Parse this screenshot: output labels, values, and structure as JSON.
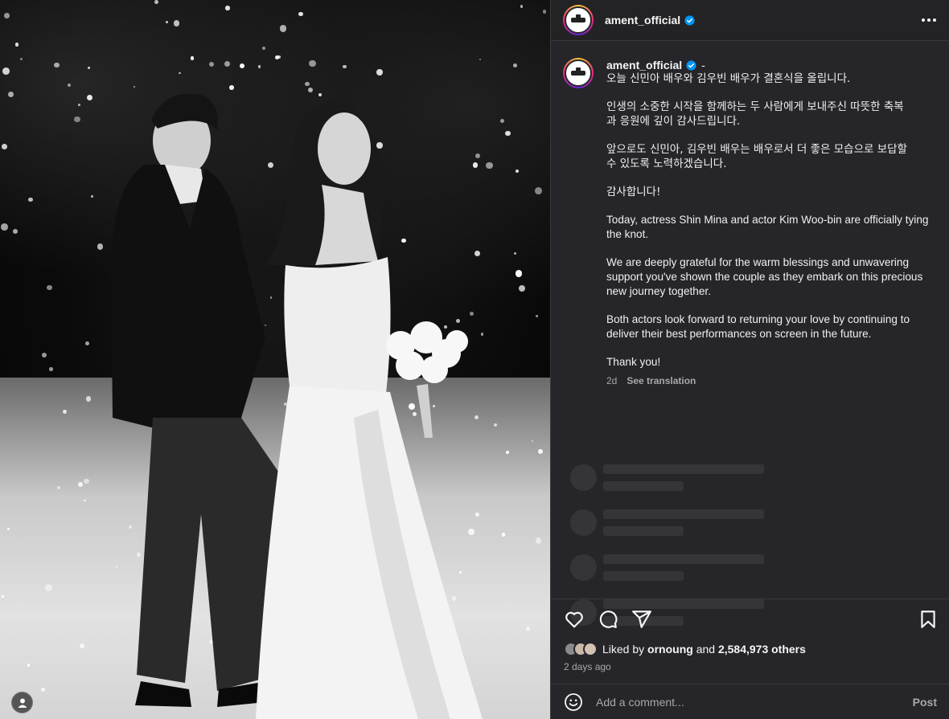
{
  "post": {
    "username": "ament_official",
    "verified": true,
    "caption_dash": "-",
    "caption_ko": [
      "오늘 신민아 배우와 김우빈 배우가 결혼식을 올립니다.",
      "인생의 소중한 시작을 함께하는 두 사람에게 보내주신 따뜻한 축복\n과 응원에 깊이 감사드립니다.",
      "앞으로도 신민아, 김우빈 배우는 배우로서 더 좋은 모습으로 보답할\n수 있도록 노력하겠습니다.",
      "감사합니다!"
    ],
    "caption_en": [
      "Today, actress Shin Mina and actor Kim Woo-bin are officially tying\nthe knot.",
      "We are deeply grateful for the warm blessings and unwavering\nsupport you've shown the couple as they embark on this precious\nnew journey together.",
      "Both actors look forward to returning your love by continuing to\ndeliver their best performances on screen in the future.",
      "Thank you!"
    ],
    "age_short": "2d",
    "see_translation": "See translation",
    "likes_prefix": "Liked by",
    "liked_by_user": "ornoung",
    "likes_and": "and",
    "likes_count": "2,584,973 others",
    "posted_ago": "2 days ago"
  },
  "comment": {
    "placeholder": "Add a comment...",
    "post_label": "Post"
  },
  "icons": {
    "more": "more-options-icon",
    "like": "heart-icon",
    "comment": "comment-icon",
    "share": "share-icon",
    "save": "bookmark-icon",
    "emoji": "emoji-icon",
    "profile": "user-profile-icon"
  },
  "colors": {
    "panel_bg": "#26262a",
    "verified_blue": "#0095f6",
    "muted": "#a8a8a8"
  }
}
